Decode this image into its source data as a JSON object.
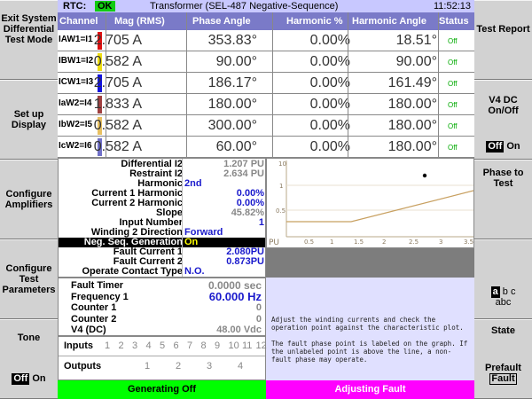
{
  "left_buttons": [
    {
      "label": "Exit System Differential Test Mode"
    },
    {
      "label": "Set up Display"
    },
    {
      "label": "Configure Amplifiers"
    },
    {
      "label": "Configure Test Parameters"
    },
    {
      "label": "Tone",
      "off": "Off",
      "on": "On"
    }
  ],
  "right_buttons": [
    {
      "label": "Test Report"
    },
    {
      "label": "V4 DC On/Off",
      "off": "Off",
      "on": "On"
    },
    {
      "label": "Phase to Test",
      "opt_a": "a",
      "opt_b": "b",
      "opt_c": "c",
      "opt_abc": "abc"
    },
    {
      "label": "State",
      "opt_prefault": "Prefault",
      "opt_fault": "Fault"
    }
  ],
  "topbar": {
    "rtc_label": "RTC:",
    "rtc_status": "OK",
    "title": "Transformer (SEL-487 Negative-Sequence)",
    "clock": "11:52:13"
  },
  "table": {
    "headers": [
      "Channel",
      "Mag (RMS)",
      "Phase Angle",
      "Harmonic %",
      "Harmonic Angle",
      "Status"
    ],
    "rows": [
      {
        "channel": "IAW1=I1",
        "color": "#dd1111",
        "mag": "2.705 A",
        "angle": "353.83°",
        "harm_pct": "0.00%",
        "harm_angle": "18.51°",
        "status": "Off"
      },
      {
        "channel": "IBW1=I2",
        "color": "#eedd11",
        "mag": "0.582 A",
        "angle": "90.00°",
        "harm_pct": "0.00%",
        "harm_angle": "90.00°",
        "status": "Off"
      },
      {
        "channel": "ICW1=I3",
        "color": "#1111dd",
        "mag": "2.705 A",
        "angle": "186.17°",
        "harm_pct": "0.00%",
        "harm_angle": "161.49°",
        "status": "Off"
      },
      {
        "channel": "IaW2=I4",
        "color": "#a04040",
        "mag": "1.833 A",
        "angle": "180.00°",
        "harm_pct": "0.00%",
        "harm_angle": "180.00°",
        "status": "Off"
      },
      {
        "channel": "IbW2=I5",
        "color": "#e8c060",
        "mag": "0.582 A",
        "angle": "300.00°",
        "harm_pct": "0.00%",
        "harm_angle": "180.00°",
        "status": "Off"
      },
      {
        "channel": "IcW2=I6",
        "color": "#7070c8",
        "mag": "0.582 A",
        "angle": "60.00°",
        "harm_pct": "0.00%",
        "harm_angle": "180.00°",
        "status": "Off"
      }
    ]
  },
  "params": [
    {
      "label": "Differential I2",
      "value": "1.207 PU",
      "style": "gray"
    },
    {
      "label": "Restraint I2",
      "value": "2.634 PU",
      "style": "gray"
    },
    {
      "label": "Harmonic",
      "value": "2nd",
      "style": "blue"
    },
    {
      "label": "Current 1 Harmonic",
      "value": "0.00%",
      "style": "bluer"
    },
    {
      "label": "Current 2 Harmonic",
      "value": "0.00%",
      "style": "bluer"
    },
    {
      "label": "Slope",
      "value": "45.82%",
      "style": "gray"
    },
    {
      "label": "Input Number",
      "value": "1",
      "style": "bluer"
    },
    {
      "label": "Winding 2 Direction",
      "value": "Forward",
      "style": "blue"
    },
    {
      "label": "Neg. Seq. Generation",
      "value": "On",
      "style": "hl"
    },
    {
      "label": "Fault Current 1",
      "value": "2.080PU",
      "style": "bluer"
    },
    {
      "label": "Fault Current 2",
      "value": "0.873PU",
      "style": "bluer"
    },
    {
      "label": "Operate Contact Type",
      "value": "N.O.",
      "style": "blue"
    }
  ],
  "plot": {
    "y_ticks": [
      "10",
      "1",
      "0.5"
    ],
    "x_ticks": [
      "PU",
      "0.5",
      "1",
      "1.5",
      "2",
      "2.5",
      "3",
      "3.5"
    ]
  },
  "timers": [
    {
      "label": "Fault Timer",
      "value": "0.0000 sec",
      "style": "mid"
    },
    {
      "label": "Frequency 1",
      "value": "60.000 Hz",
      "style": "big"
    },
    {
      "label": "Counter 1",
      "value": "0",
      "style": ""
    },
    {
      "label": "Counter 2",
      "value": "0",
      "style": ""
    },
    {
      "label": "V4 (DC)",
      "value": "48.00 Vdc",
      "style": ""
    }
  ],
  "help": {
    "p1": "Adjust the winding currents and check the operation point against the characteristic plot.",
    "p2": "The fault phase point is labeled on the graph. If the unlabeled point is above the line, a non-fault phase may operate."
  },
  "io": {
    "inputs_label": "Inputs",
    "inputs": [
      "1",
      "2",
      "3",
      "4",
      "5",
      "6",
      "7",
      "8",
      "9",
      "10",
      "11",
      "12"
    ],
    "outputs_label": "Outputs",
    "outputs": [
      "1",
      "2",
      "3",
      "4"
    ]
  },
  "status": {
    "left": "Generating Off",
    "right": "Adjusting Fault"
  },
  "colors": {
    "header": "#7a7ac8",
    "generating": "#00ff00",
    "adjusting": "#ff00ff",
    "plot_line": "#c8a060",
    "plot_axes": "#b8a888"
  }
}
